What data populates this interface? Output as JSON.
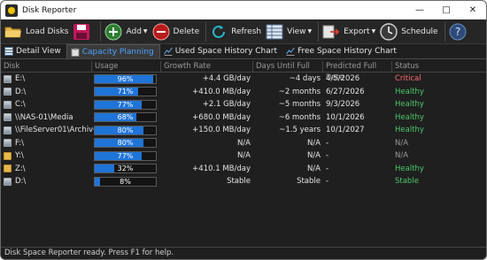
{
  "window": {
    "title": "Disk Reporter"
  },
  "toolbar": {
    "load": "Load Disks",
    "add": "Add",
    "delete": "Delete",
    "refresh": "Refresh",
    "view": "View",
    "export": "Export",
    "schedule": "Schedule"
  },
  "tabs": [
    "Detail View",
    "Capacity Planning",
    "Used Space History Chart",
    "Free Space History Chart"
  ],
  "columns": [
    "Disk",
    "Usage",
    "Growth Rate",
    "Days Until Full",
    "Predicted Full Date",
    "Status"
  ],
  "rows": [
    {
      "disk": "E:\\",
      "icon": "drive-icon",
      "usage": 96,
      "usage_label": "96%",
      "growth": "+4.4 GB/day",
      "days": "~4 days",
      "date": "4/5/2026",
      "status": "Critical",
      "kind": "critical"
    },
    {
      "disk": "D:\\",
      "icon": "drive-icon",
      "usage": 71,
      "usage_label": "71%",
      "growth": "+410.0 MB/day",
      "days": "~2 months",
      "date": "6/27/2026",
      "status": "Healthy",
      "kind": "healthy"
    },
    {
      "disk": "C:\\",
      "icon": "drive-icon",
      "usage": 77,
      "usage_label": "77%",
      "growth": "+2.1 GB/day",
      "days": "~5 months",
      "date": "9/3/2026",
      "status": "Healthy",
      "kind": "healthy"
    },
    {
      "disk": "\\\\NAS-01\\Media",
      "icon": "drive-icon",
      "usage": 68,
      "usage_label": "68%",
      "growth": "+680.0 MB/day",
      "days": "~6 months",
      "date": "10/1/2026",
      "status": "Healthy",
      "kind": "healthy"
    },
    {
      "disk": "\\\\FileServer01\\Archives",
      "icon": "drive-icon",
      "usage": 80,
      "usage_label": "80%",
      "growth": "+150.0 MB/day",
      "days": "~1.5 years",
      "date": "10/1/2027",
      "status": "Healthy",
      "kind": "healthy"
    },
    {
      "disk": "F:\\",
      "icon": "drive-icon",
      "usage": 80,
      "usage_label": "80%",
      "growth": "N/A",
      "days": "N/A",
      "date": "-",
      "status": "N/A",
      "kind": "na"
    },
    {
      "disk": "Y:\\",
      "icon": "folder-icon",
      "usage": 77,
      "usage_label": "77%",
      "growth": "N/A",
      "days": "N/A",
      "date": "-",
      "status": "N/A",
      "kind": "na"
    },
    {
      "disk": "Z:\\",
      "icon": "folder-icon",
      "usage": 32,
      "usage_label": "32%",
      "growth": "+410.1 MB/day",
      "days": "N/A",
      "date": "-",
      "status": "Healthy",
      "kind": "healthy"
    },
    {
      "disk": "D:\\",
      "icon": "drive-icon",
      "usage": 8,
      "usage_label": "8%",
      "growth": "Stable",
      "days": "Stable",
      "date": "-",
      "status": "Stable",
      "kind": "healthy"
    }
  ],
  "statusbar": "Disk Space Reporter ready. Press F1 for help.",
  "colors": {
    "accent": "#4aa3ff",
    "bar": "#1f74d8",
    "critical": "#ff6a6a",
    "healthy": "#4cc86a"
  }
}
